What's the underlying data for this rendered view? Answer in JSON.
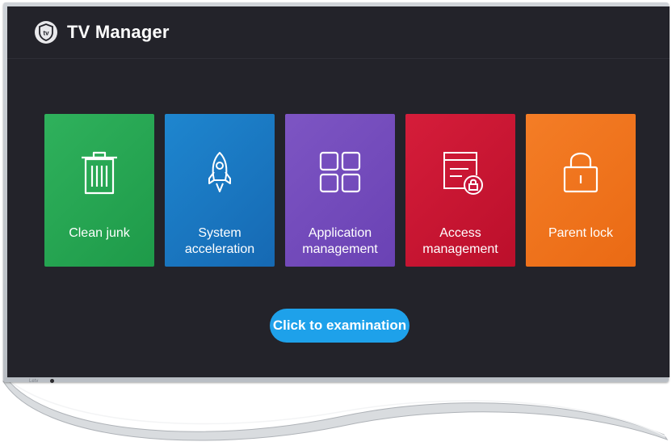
{
  "app": {
    "title": "TV Manager",
    "logo_text": "tv"
  },
  "tiles": [
    {
      "id": "clean-junk",
      "label": "Clean junk",
      "icon": "trash-icon",
      "color": "#26a653"
    },
    {
      "id": "system-acceleration",
      "label": "System\nacceleration",
      "icon": "rocket-icon",
      "color": "#1a78c2"
    },
    {
      "id": "application-management",
      "label": "Application\nmanagement",
      "icon": "grid-icon",
      "color": "#734bbb"
    },
    {
      "id": "access-management",
      "label": "Access\nmanagement",
      "icon": "locked-list-icon",
      "color": "#c8163a"
    },
    {
      "id": "parent-lock",
      "label": "Parent lock",
      "icon": "padlock-icon",
      "color": "#ef731d"
    }
  ],
  "actions": {
    "examination_label": "Click to examination"
  },
  "device": {
    "brand": "Letv"
  },
  "colors": {
    "screen_bg": "#23232a",
    "button_bg": "#1ea1ea"
  }
}
